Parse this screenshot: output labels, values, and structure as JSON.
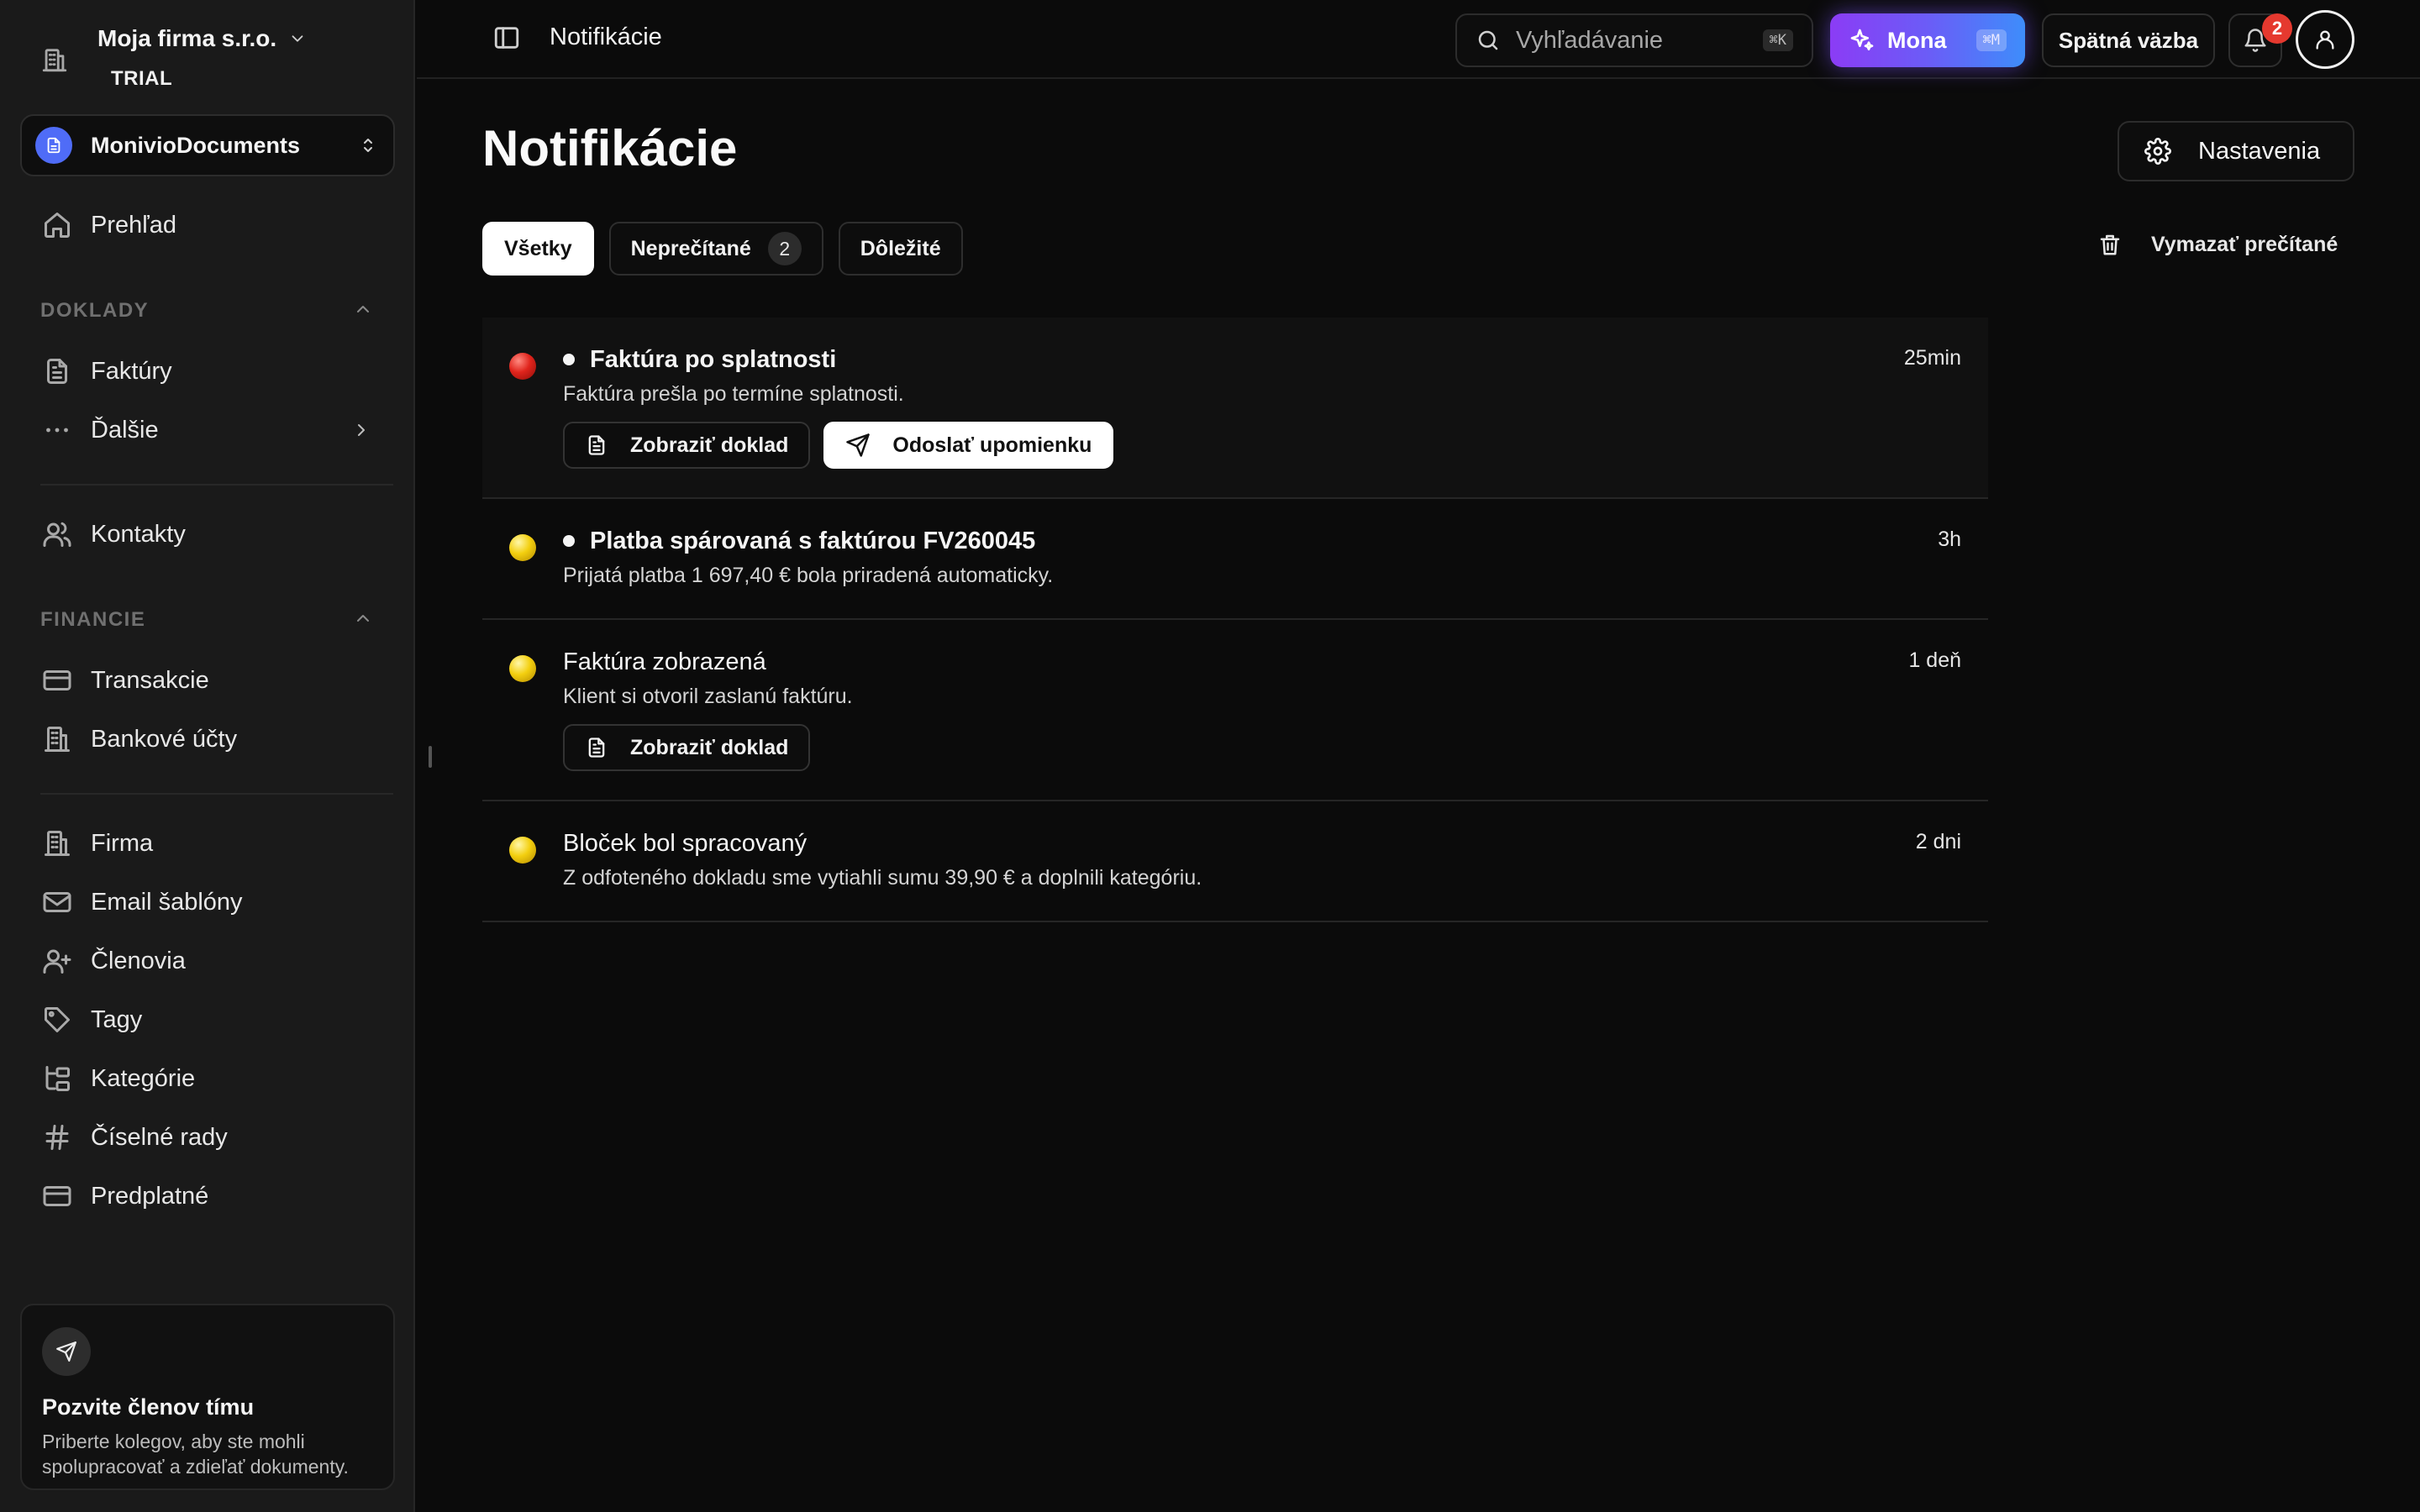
{
  "sidebar": {
    "org_name": "Moja firma s.r.o.",
    "org_plan": "TRIAL",
    "app_name": "MonivioDocuments",
    "overview": "Prehľad",
    "section_documents": "DOKLADY",
    "invoices": "Faktúry",
    "more": "Ďalšie",
    "contacts": "Kontakty",
    "section_finance": "FINANCIE",
    "transactions": "Transakcie",
    "bank_accounts": "Bankové účty",
    "company": "Firma",
    "email_templates": "Email šablóny",
    "members": "Členovia",
    "tags": "Tagy",
    "categories": "Kategórie",
    "number_series": "Číselné rady",
    "subscription": "Predplatné",
    "invite_title": "Pozvite členov tímu",
    "invite_text": "Priberte kolegov, aby ste mohli spolupracovať a zdieľať dokumenty."
  },
  "topbar": {
    "title": "Notifikácie",
    "search_placeholder": "Vyhľadávanie",
    "search_shortcut": "⌘K",
    "mona_label": "Mona",
    "mona_shortcut": "⌘M",
    "feedback_label": "Spätná väzba",
    "notification_count": "2"
  },
  "page": {
    "title": "Notifikácie",
    "settings_label": "Nastavenia",
    "clear_read_label": "Vymazať prečítané",
    "tabs": {
      "all": "Všetky",
      "unread": "Neprečítané",
      "unread_count": "2",
      "important": "Dôležité"
    }
  },
  "notifications": [
    {
      "title": "Faktúra po splatnosti",
      "desc": "Faktúra prešla po termíne splatnosti.",
      "time": "25min",
      "severity_color": "#e0241c",
      "unread": true,
      "action_view": "Zobraziť doklad",
      "action_remind": "Odoslať upomienku"
    },
    {
      "title": "Platba spárovaná s faktúrou FV260045",
      "desc": "Prijatá platba 1 697,40 € bola priradená automaticky.",
      "time": "3h",
      "severity_color": "#f3cf0f",
      "unread": true
    },
    {
      "title": "Faktúra zobrazená",
      "desc": "Klient si otvoril zaslanú faktúru.",
      "time": "1 deň",
      "severity_color": "#f3cf0f",
      "unread": false,
      "action_view": "Zobraziť doklad"
    },
    {
      "title": "Bloček bol spracovaný",
      "desc": "Z odfoteného dokladu sme vytiahli sumu 39,90 € a doplnili kategóriu.",
      "time": "2 dni",
      "severity_color": "#f3cf0f",
      "unread": false
    }
  ],
  "colors": {
    "accent_gradient_start": "#8b3cf5",
    "accent_gradient_end": "#3e8dfb",
    "badge_red": "#e5392f",
    "background": "#0b0b0b",
    "sidebar": "#1a1a1a"
  }
}
